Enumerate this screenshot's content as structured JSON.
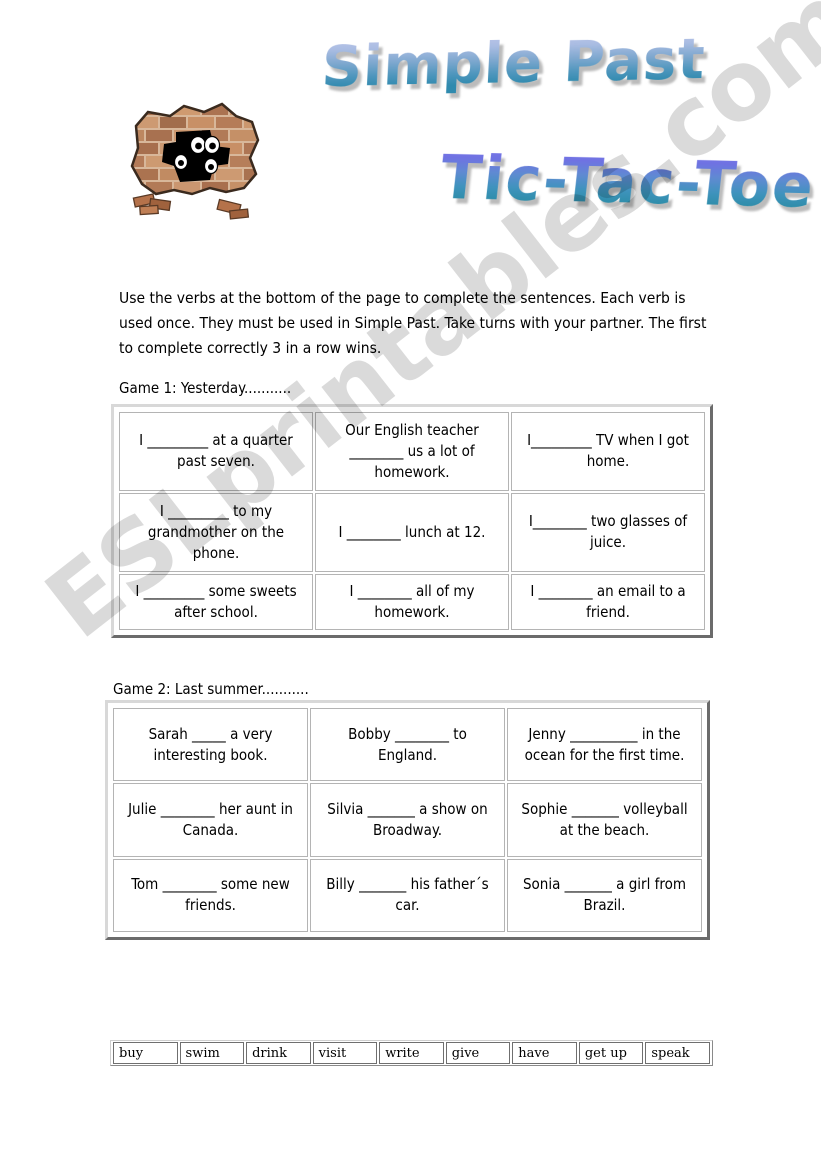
{
  "page": {
    "title_main": "Simple Past",
    "title_sub": "Tic-Tac-Toe",
    "clipart_name": "brick-wall-hole-with-eyes",
    "watermark": "ESLprintables.com",
    "colors": {
      "title_main_top": "#b9c4e8",
      "title_main_bottom": "#2f8aae",
      "title_sub_top": "#7a78e8",
      "title_sub_bottom": "#2e8da9",
      "title_shadow": "#969696",
      "grid_border_light": "#d8d8d8",
      "grid_border_dark": "#6b6b6b",
      "cell_border": "#b4b4b4",
      "text": "#000000",
      "watermark_gray": "#d5d5d5"
    }
  },
  "instructions": {
    "text": "Use the verbs at the bottom of the page to complete the sentences. Each verb is used once. They must be used in Simple Past. Take turns with your partner. The first to complete correctly 3 in a row wins."
  },
  "games": [
    {
      "label": "Game 1: Yesterday...........",
      "cells": [
        "I _________ at a quarter past seven.",
        "Our English teacher ________ us a lot of homework.",
        "I_________ TV when I got home.",
        "I _________ to my grandmother on the phone.",
        "I ________ lunch at 12.",
        "I________ two glasses of juice.",
        "I _________ some sweets after school.",
        "I ________ all of my homework.",
        "I ________ an email to a friend."
      ]
    },
    {
      "label": "Game 2: Last summer...........",
      "cells": [
        "Sarah _____ a very interesting book.",
        "Bobby ________ to England.",
        "Jenny __________ in the ocean for the first time.",
        "Julie ________ her aunt in Canada.",
        "Silvia _______ a show on Broadway.",
        "Sophie _______ volleyball at the beach.",
        "Tom ________ some new friends.",
        "Billy _______ his father´s car.",
        "Sonia _______ a girl from Brazil."
      ]
    }
  ],
  "verb_bank": {
    "verbs": [
      "buy",
      "swim",
      "drink",
      "visit",
      "write",
      "give",
      "have",
      "get up",
      "speak"
    ]
  }
}
